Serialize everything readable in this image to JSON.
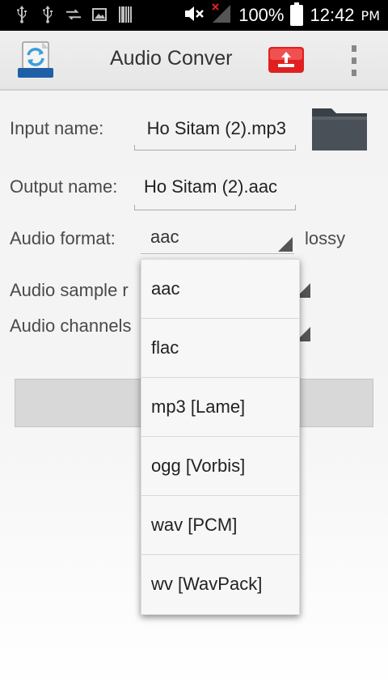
{
  "status_bar": {
    "battery": "100%",
    "time": "12:42",
    "ampm": "PM"
  },
  "action_bar": {
    "title": "Audio Conver"
  },
  "form": {
    "input_label": "Input name:",
    "input_value": "Ho Sitam (2).mp3",
    "output_label": "Output name:",
    "output_value": "Ho Sitam (2).aac",
    "format_label": "Audio format:",
    "format_value": "aac",
    "format_note": "lossy",
    "sample_rate_label": "Audio sample r",
    "channels_label": "Audio channels"
  },
  "dropdown": {
    "options": [
      "aac",
      "flac",
      "mp3 [Lame]",
      "ogg [Vorbis]",
      "wav [PCM]",
      "wv [WavPack]"
    ]
  },
  "colors": {
    "export_red": "#e02020",
    "folder_gray": "#4a5058"
  }
}
